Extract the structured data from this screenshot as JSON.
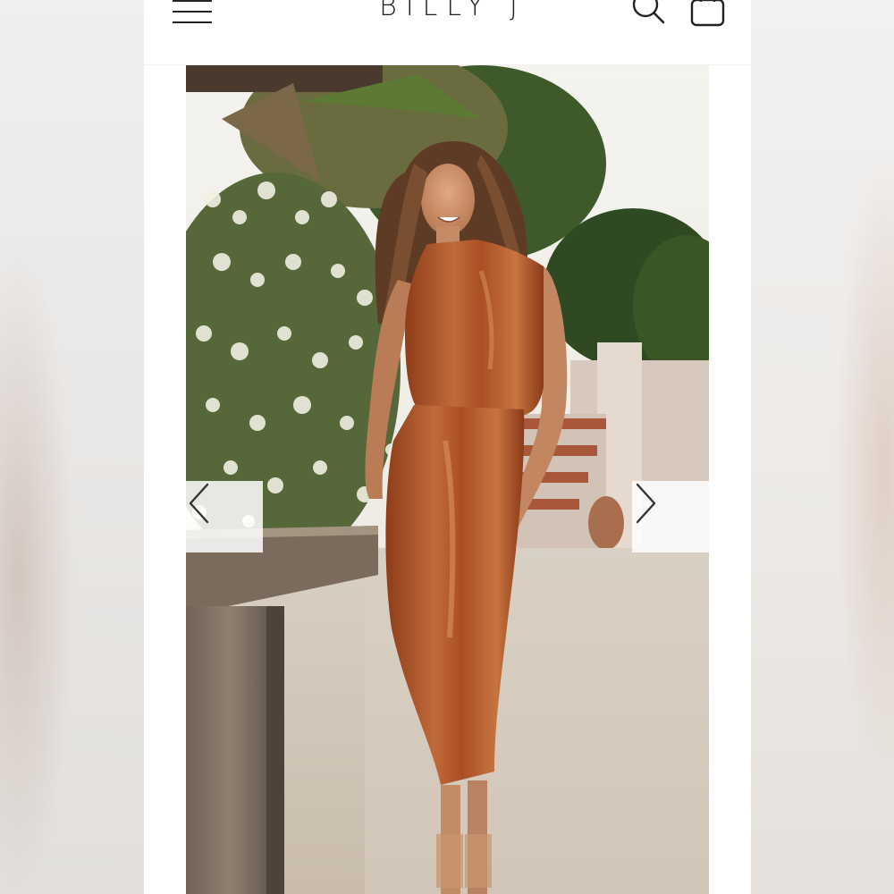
{
  "header": {
    "brand": "BILLY J",
    "menu_icon": "hamburger-menu-icon",
    "search_icon": "search-icon",
    "cart_icon": "shopping-bag-icon"
  },
  "gallery": {
    "image": "product-photo-woman-rust-satin-halter-midi-dress",
    "prev_icon": "chevron-left-icon",
    "next_icon": "chevron-right-icon"
  },
  "colors": {
    "dress": "#b3552a",
    "background_white": "#ffffff",
    "icon_dark": "#222222"
  }
}
